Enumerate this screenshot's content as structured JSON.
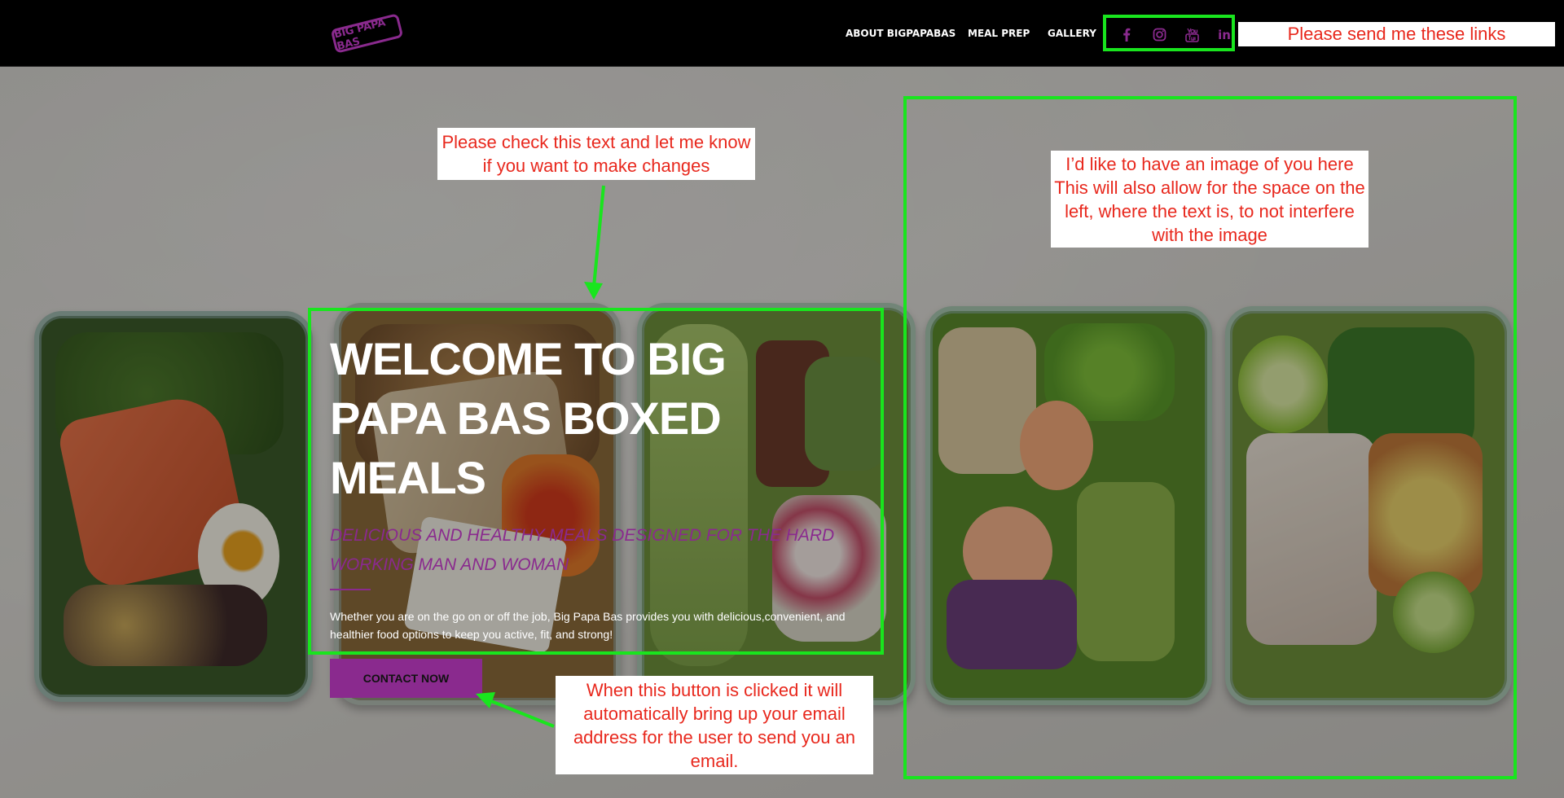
{
  "brand": {
    "logo_text": "BIG PAPA BAS"
  },
  "nav": {
    "items": [
      {
        "label": "ABOUT BIGPAPABAS"
      },
      {
        "label": "MEAL PREP"
      },
      {
        "label": "GALLERY"
      }
    ]
  },
  "social": {
    "icons": [
      "facebook-icon",
      "instagram-icon",
      "youtube-icon",
      "linkedin-icon"
    ],
    "linkedin_glyph": "in"
  },
  "hero": {
    "title": "WELCOME TO BIG PAPA BAS BOXED MEALS",
    "subtitle": "DELICIOUS AND HEALTHY MEALS DESIGNED FOR THE HARD WORKING MAN AND WOMAN",
    "body": "Whether you are on the go on or off the job, Big Papa Bas provides you with delicious,convenient, and healthier food options to keep you active, fit, and strong!",
    "cta_label": "CONTACT NOW"
  },
  "notes": {
    "links": "Please send me these links",
    "text_check": "Please check this text and let me know if you want to make changes",
    "image": "I’d like to have an image of you here This will also allow for the space on the left, where the text is, to not interfere with the image",
    "button": "When this button is clicked it will automatically bring up your email address for the user to send you an email."
  },
  "colors": {
    "brand_purple": "#8a2a8e",
    "annotation_green": "#19e51e",
    "annotation_red": "#e8281d",
    "header_bg": "#000000"
  }
}
